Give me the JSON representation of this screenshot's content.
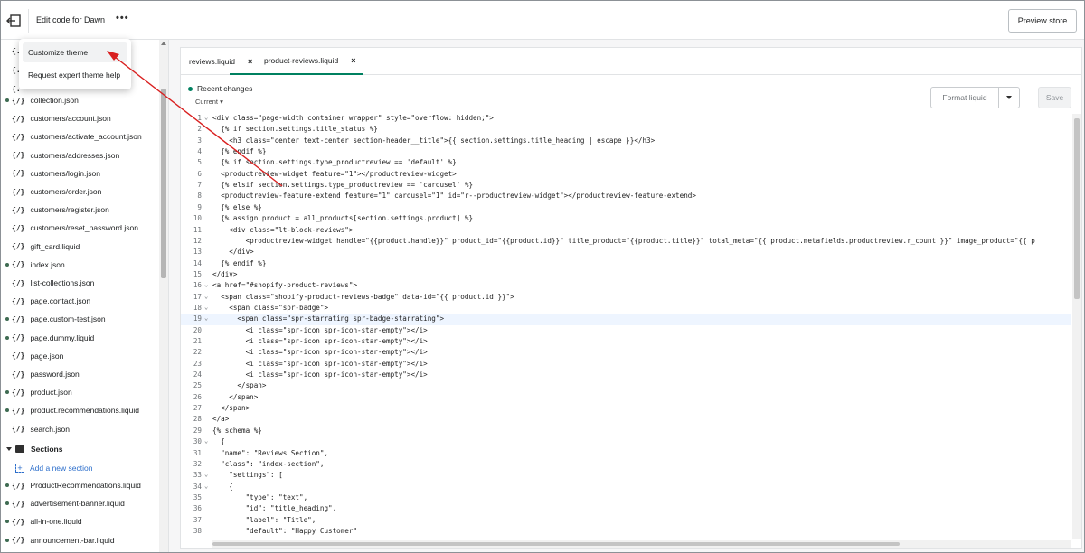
{
  "topbar": {
    "title": "Edit code for Dawn",
    "more_label": "•••",
    "preview_label": "Preview store"
  },
  "menu": {
    "items": [
      {
        "label": "Customize theme"
      },
      {
        "label": "Request expert theme help"
      }
    ]
  },
  "sidebar": {
    "top_partials": [
      "{.",
      "{.",
      "{."
    ],
    "files": [
      {
        "name": "collection.json",
        "modified": true
      },
      {
        "name": "customers/account.json",
        "modified": false
      },
      {
        "name": "customers/activate_account.json",
        "modified": false
      },
      {
        "name": "customers/addresses.json",
        "modified": false
      },
      {
        "name": "customers/login.json",
        "modified": false
      },
      {
        "name": "customers/order.json",
        "modified": false
      },
      {
        "name": "customers/register.json",
        "modified": false
      },
      {
        "name": "customers/reset_password.json",
        "modified": false
      },
      {
        "name": "gift_card.liquid",
        "modified": false
      },
      {
        "name": "index.json",
        "modified": true
      },
      {
        "name": "list-collections.json",
        "modified": false
      },
      {
        "name": "page.contact.json",
        "modified": false
      },
      {
        "name": "page.custom-test.json",
        "modified": true
      },
      {
        "name": "page.dummy.liquid",
        "modified": true
      },
      {
        "name": "page.json",
        "modified": false
      },
      {
        "name": "password.json",
        "modified": false
      },
      {
        "name": "product.json",
        "modified": true
      },
      {
        "name": "product.recommendations.liquid",
        "modified": true
      },
      {
        "name": "search.json",
        "modified": false
      }
    ],
    "section_heading": "Sections",
    "add_section": "Add a new section",
    "section_files": [
      {
        "name": "ProductRecommendations.liquid",
        "modified": true
      },
      {
        "name": "advertisement-banner.liquid",
        "modified": true
      },
      {
        "name": "all-in-one.liquid",
        "modified": true
      },
      {
        "name": "announcement-bar.liquid",
        "modified": true
      }
    ],
    "brace": "{/}"
  },
  "tabs": [
    {
      "label": "reviews.liquid",
      "close": "×"
    },
    {
      "label": "product-reviews.liquid",
      "close": "×"
    }
  ],
  "toolbar": {
    "recent_changes": "Recent changes",
    "current": "Current",
    "format_label": "Format liquid",
    "save_label": "Save"
  },
  "code_lines": [
    {
      "n": "1",
      "fold": "⌄",
      "text": "<div class=\"page-width container wrapper\" style=\"overflow: hidden;\">"
    },
    {
      "n": "2",
      "fold": "",
      "text": "  {% if section.settings.title_status %}"
    },
    {
      "n": "3",
      "fold": "",
      "text": "    <h3 class=\"center text-center section-header__title\">{{ section.settings.title_heading | escape }}</h3>"
    },
    {
      "n": "4",
      "fold": "",
      "text": "  {% endif %}"
    },
    {
      "n": "5",
      "fold": "",
      "text": "  {% if section.settings.type_productreview == 'default' %}"
    },
    {
      "n": "6",
      "fold": "",
      "text": "  <productreview-widget feature=\"1\"></productreview-widget>"
    },
    {
      "n": "7",
      "fold": "",
      "text": "  {% elsif section.settings.type_productreview == 'carousel' %}"
    },
    {
      "n": "8",
      "fold": "",
      "text": "  <productreview-feature-extend feature=\"1\" carousel=\"1\" id=\"r--productreview-widget\"></productreview-feature-extend>"
    },
    {
      "n": "9",
      "fold": "",
      "text": "  {% else %}"
    },
    {
      "n": "10",
      "fold": "",
      "text": "  {% assign product = all_products[section.settings.product] %}"
    },
    {
      "n": "11",
      "fold": "",
      "text": "    <div class=\"lt-block-reviews\">"
    },
    {
      "n": "12",
      "fold": "",
      "text": "        <productreview-widget handle=\"{{product.handle}}\" product_id=\"{{product.id}}\" title_product=\"{{product.title}}\" total_meta=\"{{ product.metafields.productreview.r_count }}\" image_product=\"{{ p"
    },
    {
      "n": "13",
      "fold": "",
      "text": "    </div>"
    },
    {
      "n": "14",
      "fold": "",
      "text": "  {% endif %}"
    },
    {
      "n": "15",
      "fold": "",
      "text": "</div>"
    },
    {
      "n": "16",
      "fold": "⌄",
      "text": "<a href=\"#shopify-product-reviews\">"
    },
    {
      "n": "17",
      "fold": "⌄",
      "text": "  <span class=\"shopify-product-reviews-badge\" data-id=\"{{ product.id }}\">"
    },
    {
      "n": "18",
      "fold": "⌄",
      "text": "    <span class=\"spr-badge\">"
    },
    {
      "n": "19",
      "fold": "⌄",
      "text": "      <span class=\"spr-starrating spr-badge-starrating\">"
    },
    {
      "n": "20",
      "fold": "",
      "text": "        <i class=\"spr-icon spr-icon-star-empty\"></i>"
    },
    {
      "n": "21",
      "fold": "",
      "text": "        <i class=\"spr-icon spr-icon-star-empty\"></i>"
    },
    {
      "n": "22",
      "fold": "",
      "text": "        <i class=\"spr-icon spr-icon-star-empty\"></i>"
    },
    {
      "n": "23",
      "fold": "",
      "text": "        <i class=\"spr-icon spr-icon-star-empty\"></i>"
    },
    {
      "n": "24",
      "fold": "",
      "text": "        <i class=\"spr-icon spr-icon-star-empty\"></i>"
    },
    {
      "n": "25",
      "fold": "",
      "text": "      </span>"
    },
    {
      "n": "26",
      "fold": "",
      "text": "    </span>"
    },
    {
      "n": "27",
      "fold": "",
      "text": "  </span>"
    },
    {
      "n": "28",
      "fold": "",
      "text": "</a>"
    },
    {
      "n": "29",
      "fold": "",
      "text": "{% schema %}"
    },
    {
      "n": "30",
      "fold": "⌄",
      "text": "  {"
    },
    {
      "n": "31",
      "fold": "",
      "text": "  \"name\": \"Reviews Section\","
    },
    {
      "n": "32",
      "fold": "",
      "text": "  \"class\": \"index-section\","
    },
    {
      "n": "33",
      "fold": "⌄",
      "text": "    \"settings\": ["
    },
    {
      "n": "34",
      "fold": "⌄",
      "text": "    {"
    },
    {
      "n": "35",
      "fold": "",
      "text": "        \"type\": \"text\","
    },
    {
      "n": "36",
      "fold": "",
      "text": "        \"id\": \"title_heading\","
    },
    {
      "n": "37",
      "fold": "",
      "text": "        \"label\": \"Title\","
    },
    {
      "n": "38",
      "fold": "",
      "text": "        \"default\": \"Happy Customer\""
    }
  ],
  "highlight_line": "19"
}
